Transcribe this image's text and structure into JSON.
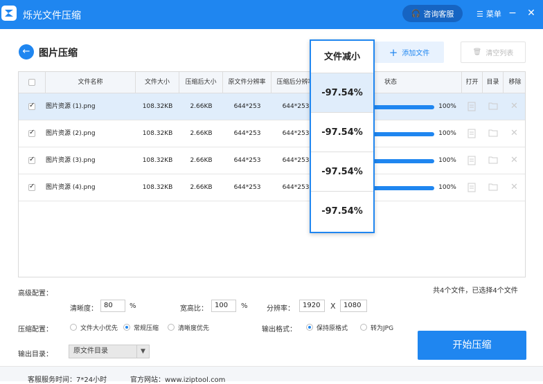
{
  "app": {
    "title": "烁光文件压缩",
    "consult_label": "咨询客服",
    "menu_label": "菜单",
    "minimize": "−",
    "close": "✕"
  },
  "page": {
    "title": "图片压缩",
    "add_file": "添加文件",
    "clear_list": "清空列表"
  },
  "table": {
    "headers": {
      "name": "文件名称",
      "size": "文件大小",
      "compressed_size": "压缩后大小",
      "orig_res": "原文件分辨率",
      "new_res": "压缩后分辨率",
      "status": "状态",
      "open": "打开",
      "dir": "目录",
      "remove": "移除"
    },
    "rows": [
      {
        "name": "图片资源 (1).png",
        "size": "108.32KB",
        "compressed_size": "2.66KB",
        "orig_res": "644*253",
        "new_res": "644*253",
        "progress": "100%"
      },
      {
        "name": "图片资源 (2).png",
        "size": "108.32KB",
        "compressed_size": "2.66KB",
        "orig_res": "644*253",
        "new_res": "644*253",
        "progress": "100%"
      },
      {
        "name": "图片资源 (3).png",
        "size": "108.32KB",
        "compressed_size": "2.66KB",
        "orig_res": "644*253",
        "new_res": "644*253",
        "progress": "100%"
      },
      {
        "name": "图片资源 (4).png",
        "size": "108.32KB",
        "compressed_size": "2.66KB",
        "orig_res": "644*253",
        "new_res": "644*253",
        "progress": "100%"
      }
    ]
  },
  "popup": {
    "header": "文件减小",
    "values": [
      "-97.54%",
      "-97.54%",
      "-97.54%",
      "-97.54%"
    ]
  },
  "summary": "共4个文件，已选择4个文件",
  "settings": {
    "advanced_label": "高级配置：",
    "clarity_label": "清晰度：",
    "clarity_value": "80",
    "clarity_unit": "%",
    "aspect_label": "宽高比：",
    "aspect_value": "100",
    "aspect_unit": "%",
    "resolution_label": "分辨率：",
    "res_w": "1920",
    "res_x": "X",
    "res_h": "1080",
    "compress_label": "压缩配置：",
    "compress_options": [
      "文件大小优先",
      "常规压缩",
      "清晰度优先"
    ],
    "compress_selected": "常规压缩",
    "format_label": "输出格式：",
    "format_options": [
      "保持原格式",
      "转为JPG"
    ],
    "format_selected": "保持原格式",
    "output_label": "输出目录：",
    "output_value": "原文件目录"
  },
  "start_button": "开始压缩",
  "footer": {
    "service_time": "客服服务时间：7*24小时",
    "website": "官方网站：www.iziptool.com"
  }
}
